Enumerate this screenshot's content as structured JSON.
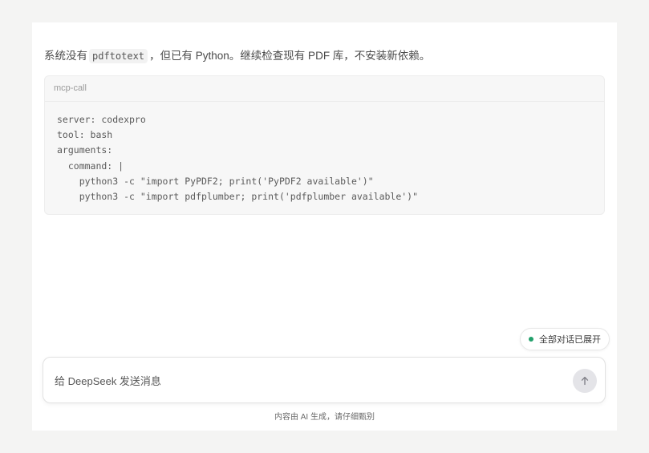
{
  "message": {
    "prefix": "系统没有",
    "code": "pdftotext",
    "suffix": "，但已有 Python。继续检查现有 PDF 库，不安装新依赖。"
  },
  "code_block": {
    "language": "mcp-call",
    "content": "server: codexpro\ntool: bash\narguments:\n  command: |\n    python3 -c \"import PyPDF2; print('PyPDF2 available')\"\n    python3 -c \"import pdfplumber; print('pdfplumber available')\""
  },
  "status": {
    "label": "全部对话已展开",
    "dot_color": "#22a06b"
  },
  "composer": {
    "placeholder": "给 DeepSeek 发送消息",
    "send_icon": "arrow-up-icon"
  },
  "footer": {
    "note": "内容由 AI 生成，请仔细甄别"
  }
}
